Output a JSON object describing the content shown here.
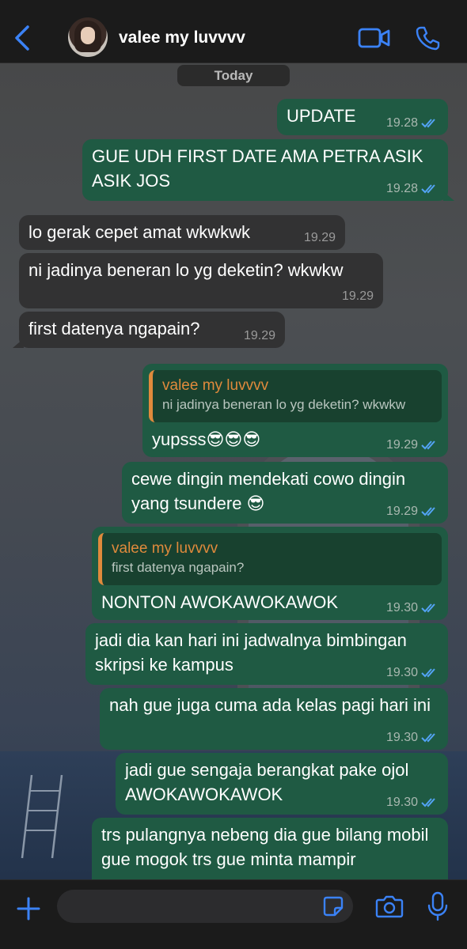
{
  "header": {
    "contact_name": "valee my luvvvv",
    "back_icon": "chevron-left-icon",
    "video_icon": "video-camera-icon",
    "call_icon": "phone-icon",
    "accent": "#3b82f6"
  },
  "chat": {
    "date_label": "Today",
    "messages": [
      {
        "text": "UPDATE",
        "time": "19.28",
        "dir": "out"
      },
      {
        "text": "GUE UDH FIRST DATE AMA PETRA ASIK ASIK JOS",
        "time": "19.28",
        "dir": "out"
      },
      {
        "text": "lo gerak cepet amat wkwkwk",
        "time": "19.29",
        "dir": "in"
      },
      {
        "text": "ni jadinya beneran lo yg deketin? wkwkw",
        "time": "19.29",
        "dir": "in"
      },
      {
        "text": "first datenya ngapain?",
        "time": "19.29",
        "dir": "in"
      },
      {
        "quote_name": "valee my luvvvv",
        "quote_text": "ni jadinya beneran lo yg deketin? wkwkw",
        "text": "yupsss😎😎😎",
        "time": "19.29",
        "dir": "out"
      },
      {
        "text": "cewe dingin mendekati cowo dingin yang tsundere 😎",
        "time": "19.29",
        "dir": "out"
      },
      {
        "quote_name": "valee my luvvvv",
        "quote_text": "first datenya ngapain?",
        "text": "NONTON AWOKAWOKAWOK",
        "time": "19.30",
        "dir": "out"
      },
      {
        "text": "jadi dia kan hari ini jadwalnya bimbingan skripsi ke kampus",
        "time": "19.30",
        "dir": "out"
      },
      {
        "text": "nah gue juga cuma ada kelas pagi hari ini",
        "time": "19.30",
        "dir": "out"
      },
      {
        "text": "jadi gue sengaja berangkat pake ojol AWOKAWOKAWOK",
        "time": "19.30",
        "dir": "out"
      },
      {
        "text": "trs pulangnya nebeng dia gue bilang mobil gue mogok trs gue minta mampir",
        "time": "",
        "dir": "out"
      }
    ],
    "outgoing_color": "#1f5a43",
    "incoming_color": "#323233",
    "read_tick_color": "#53a3f5"
  },
  "input_bar": {
    "placeholder": "",
    "plus_icon": "plus-icon",
    "sticker_icon": "sticker-icon",
    "camera_icon": "camera-icon",
    "mic_icon": "microphone-icon"
  }
}
